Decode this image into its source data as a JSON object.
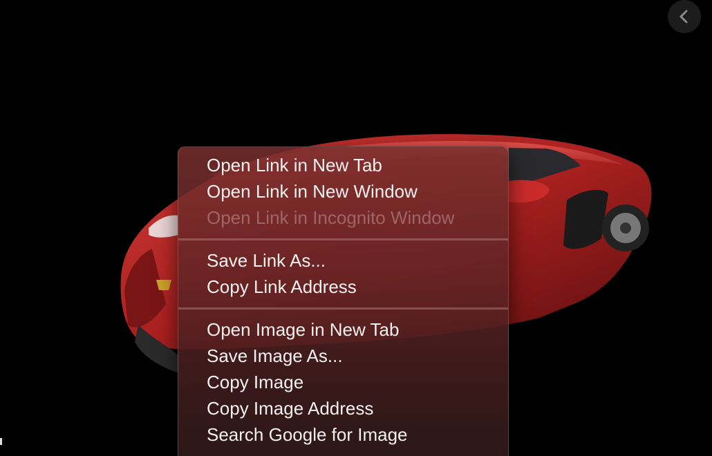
{
  "viewer": {
    "image_description_icon": "car-image",
    "back_icon": "chevron-left-icon"
  },
  "context_menu": {
    "groups": [
      {
        "items": [
          {
            "label": "Open Link in New Tab",
            "enabled": true
          },
          {
            "label": "Open Link in New Window",
            "enabled": true
          },
          {
            "label": "Open Link in Incognito Window",
            "enabled": false
          }
        ]
      },
      {
        "items": [
          {
            "label": "Save Link As...",
            "enabled": true
          },
          {
            "label": "Copy Link Address",
            "enabled": true
          }
        ]
      },
      {
        "items": [
          {
            "label": "Open Image in New Tab",
            "enabled": true
          },
          {
            "label": "Save Image As...",
            "enabled": true
          },
          {
            "label": "Copy Image",
            "enabled": true
          },
          {
            "label": "Copy Image Address",
            "enabled": true
          },
          {
            "label": "Search Google for Image",
            "enabled": true
          }
        ]
      }
    ]
  },
  "colors": {
    "background": "#000000",
    "car": "#b3262a",
    "menu_text": "#f4f0ef"
  }
}
